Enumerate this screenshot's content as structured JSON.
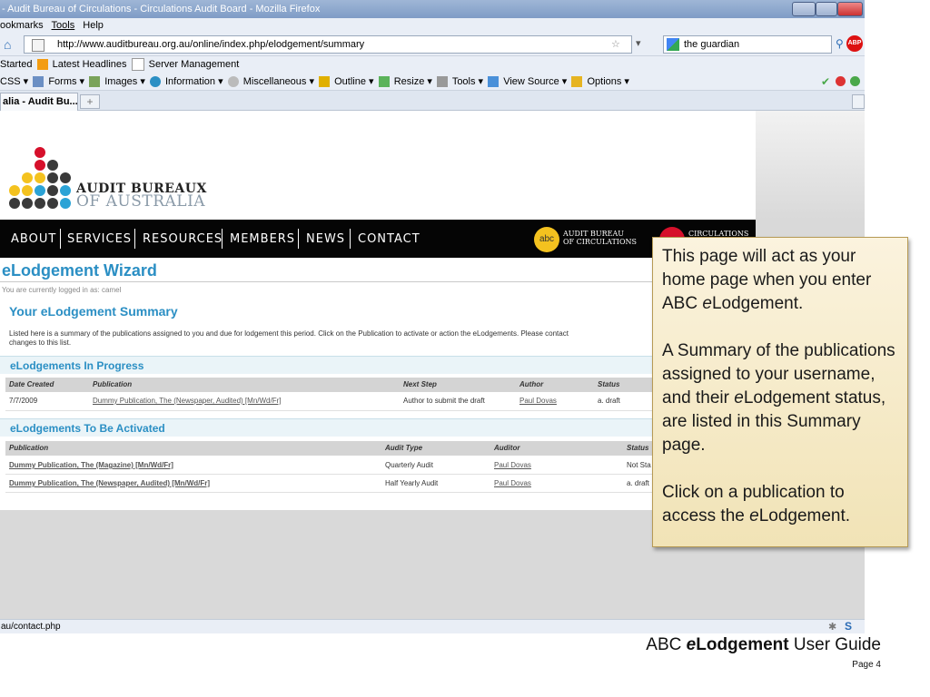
{
  "browser": {
    "title": "- Audit Bureau of Circulations - Circulations Audit Board - Mozilla Firefox",
    "menu": [
      "ookmarks",
      "Tools",
      "Help"
    ],
    "url": "http://www.auditbureau.org.au/online/index.php/elodgement/summary",
    "search_value": "the guardian",
    "bookmarks": [
      "Started",
      "Latest Headlines",
      "Server Management"
    ],
    "toolbar": [
      "CSS ▾",
      "Forms ▾",
      "Images ▾",
      "Information ▾",
      "Miscellaneous ▾",
      "Outline ▾",
      "Resize ▾",
      "Tools ▾",
      "View Source ▾",
      "Options ▾"
    ],
    "tab_title": "alia - Audit Bu...",
    "new_tab": "+",
    "status_url": "au/contact.php"
  },
  "site": {
    "logo_line1": "AUDIT BUREAUX",
    "logo_line2": "OF AUSTRALIA",
    "nav": [
      "ABOUT",
      "SERVICES",
      "RESOURCES",
      "MEMBERS",
      "NEWS",
      "CONTACT"
    ],
    "abc_badge": "abc",
    "abc_text1": "AUDIT BUREAU",
    "abc_text2": "OF CIRCULATIONS",
    "cab_text": "CIRCULATIONS"
  },
  "wizard": {
    "title": "eLodgement Wizard",
    "logged_in": "You are currently logged in as: camel",
    "summary_title": "Your eLodgement Summary",
    "intro": "Listed here is a summary of the publications assigned to you and due for lodgement this period. Click on the Publication to activate or action the eLodgements. Please contact",
    "intro2": "changes to this list.",
    "in_progress": {
      "heading": "eLodgements In Progress",
      "columns": [
        "Date Created",
        "Publication",
        "Next Step",
        "Author",
        "Status"
      ],
      "rows": [
        {
          "date": "7/7/2009",
          "publication": "Dummy Publication, The (Newspaper, Audited) [Mn/Wd/Fr]",
          "next_step": "Author to submit the draft",
          "author": "Paul Dovas",
          "status": "a. draft"
        }
      ]
    },
    "to_activate": {
      "heading": "eLodgements To Be Activated",
      "columns": [
        "Publication",
        "Audit Type",
        "Auditor",
        "Status"
      ],
      "rows": [
        {
          "publication": "Dummy Publication, The (Magazine) [Mn/Wd/Fr]",
          "audit_type": "Quarterly Audit",
          "auditor": "Paul Dovas",
          "status": "Not Sta"
        },
        {
          "publication": "Dummy Publication, The (Newspaper, Audited) [Mn/Wd/Fr]",
          "audit_type": "Half Yearly Audit",
          "auditor": "Paul Dovas",
          "status": "a. draft"
        }
      ]
    }
  },
  "callout": {
    "p1a": "This page will act as your home page when you enter ABC ",
    "p1_italic": "e",
    "p1b": "Lodgement.",
    "p2a": "A Summary of the publications assigned to your username, and their ",
    "p2_italic": "e",
    "p2b": "Lodgement status, are listed in this Summary page.",
    "p3a": "Click on a publication to access the ",
    "p3_italic": "e",
    "p3b": "Lodgement."
  },
  "footer": {
    "guide_prefix": "ABC ",
    "guide_bold": "eLodgement",
    "guide_suffix": " User Guide",
    "page": "Page 4"
  },
  "colors": {
    "accent_blue": "#2b8fc4",
    "nav_black": "#050505",
    "callout_bg": "#f4e8c4",
    "logo_red": "#d6102b",
    "logo_yellow": "#f4c21f",
    "logo_blue": "#2ba3d6",
    "logo_gray": "#3a3a3a"
  }
}
